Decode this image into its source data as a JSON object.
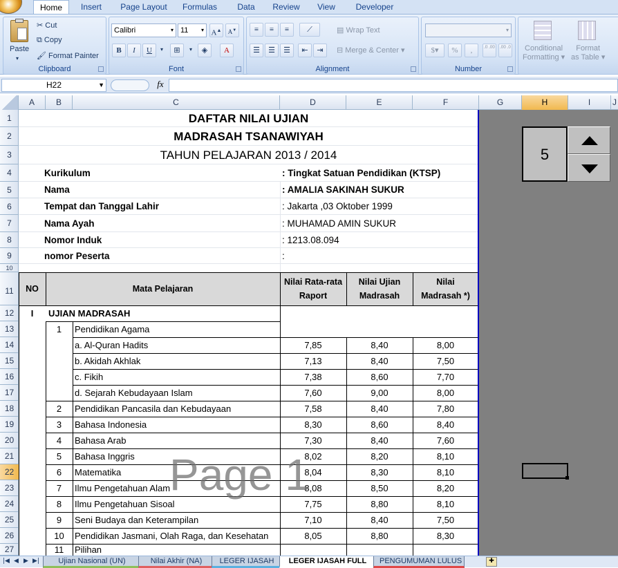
{
  "ribbon_tabs": [
    "Home",
    "Insert",
    "Page Layout",
    "Formulas",
    "Data",
    "Review",
    "View",
    "Developer"
  ],
  "clipboard": {
    "label": "Clipboard",
    "paste": "Paste",
    "cut": "Cut",
    "copy": "Copy",
    "format_painter": "Format Painter"
  },
  "font": {
    "label": "Font",
    "name": "Calibri",
    "size": "11",
    "grow": "A",
    "shrink": "A",
    "bold": "B",
    "italic": "I",
    "underline": "U",
    "font_color": "A"
  },
  "alignment": {
    "label": "Alignment",
    "wrap_text": "Wrap Text",
    "merge_center": "Merge & Center"
  },
  "number": {
    "label": "Number",
    "percent": "%",
    "comma": ",",
    "inc_decimal": ".0 .00",
    "dec_decimal": ".00 .0"
  },
  "styles": {
    "conditional": "Conditional",
    "formatting": "Formatting",
    "format": "Format",
    "as_table": "as Table"
  },
  "formula_bar": {
    "name_box": "H22",
    "fx": "fx",
    "value": ""
  },
  "columns": [
    "A",
    "B",
    "C",
    "D",
    "E",
    "F",
    "G",
    "H",
    "I",
    "J"
  ],
  "rows": [
    "1",
    "2",
    "3",
    "4",
    "5",
    "6",
    "7",
    "8",
    "9",
    "10",
    "11",
    "12",
    "13",
    "14",
    "15",
    "16",
    "17",
    "18",
    "19",
    "20",
    "21",
    "22",
    "23",
    "24",
    "25",
    "26",
    "27"
  ],
  "selected_row": "22",
  "selected_col": "H",
  "doc": {
    "title1": "DAFTAR NILAI UJIAN",
    "title2": "MADRASAH TSANAWIYAH",
    "title3": "TAHUN PELAJARAN 2013 / 2014",
    "info": [
      {
        "label": "Kurikulum",
        "value": ": Tingkat Satuan Pendidikan (KTSP)",
        "bold": true
      },
      {
        "label": "Nama",
        "value": ": AMALIA SAKINAH SUKUR",
        "bold": true
      },
      {
        "label": "Tempat dan Tanggal Lahir",
        "value": ": Jakarta ,03 Oktober 1999",
        "bold": false
      },
      {
        "label": "Nama Ayah",
        "value": ": MUHAMAD AMIN SUKUR",
        "bold": false
      },
      {
        "label": "Nomor Induk",
        "value": ": 1213.08.094",
        "bold": false
      },
      {
        "label": "nomor Peserta",
        "value": ":",
        "bold": false
      }
    ],
    "table_headers": {
      "no": "NO",
      "subject": "Mata Pelajaran",
      "raport_1": "Nilai Rata-rata",
      "raport_2": "Raport",
      "ujian_1": "Nilai Ujian",
      "ujian_2": "Madrasah",
      "nilai_1": "Nilai",
      "nilai_2": "Madrasah *)"
    },
    "section_no": "I",
    "section_title": "UJIAN MADRASAH",
    "subjects": [
      {
        "no": "1",
        "name": "Pendidikan Agama",
        "raport": "",
        "ujian": "",
        "nilai": "",
        "sub": false
      },
      {
        "no": "",
        "name": "a.  Al-Quran Hadits",
        "raport": "7,85",
        "ujian": "8,40",
        "nilai": "8,00",
        "sub": true
      },
      {
        "no": "",
        "name": "b.  Akidah Akhlak",
        "raport": "7,13",
        "ujian": "8,40",
        "nilai": "7,50",
        "sub": true
      },
      {
        "no": "",
        "name": "c.  Fikih",
        "raport": "7,38",
        "ujian": "8,60",
        "nilai": "7,70",
        "sub": true
      },
      {
        "no": "",
        "name": "d. Sejarah Kebudayaan Islam",
        "raport": "7,60",
        "ujian": "9,00",
        "nilai": "8,00",
        "sub": true
      },
      {
        "no": "2",
        "name": "Pendidikan Pancasila dan Kebudayaan",
        "raport": "7,58",
        "ujian": "8,40",
        "nilai": "7,80",
        "sub": false
      },
      {
        "no": "3",
        "name": "Bahasa Indonesia",
        "raport": "8,30",
        "ujian": "8,60",
        "nilai": "8,40",
        "sub": false
      },
      {
        "no": "4",
        "name": "Bahasa Arab",
        "raport": "7,30",
        "ujian": "8,40",
        "nilai": "7,60",
        "sub": false
      },
      {
        "no": "5",
        "name": "Bahasa Inggris",
        "raport": "8,02",
        "ujian": "8,20",
        "nilai": "8,10",
        "sub": false
      },
      {
        "no": "6",
        "name": "Matematika",
        "raport": "8,04",
        "ujian": "8,30",
        "nilai": "8,10",
        "sub": false
      },
      {
        "no": "7",
        "name": "Ilmu Pengetahuan Alam",
        "raport": "8,08",
        "ujian": "8,50",
        "nilai": "8,20",
        "sub": false
      },
      {
        "no": "8",
        "name": "Ilmu Pengetahuan Sisoal",
        "raport": "7,75",
        "ujian": "8,80",
        "nilai": "8,10",
        "sub": false
      },
      {
        "no": "9",
        "name": "Seni Budaya dan Keterampilan",
        "raport": "7,10",
        "ujian": "8,40",
        "nilai": "7,50",
        "sub": false
      },
      {
        "no": "10",
        "name": "Pendidikan Jasmani, Olah Raga, dan Kesehatan",
        "raport": "8,05",
        "ujian": "8,80",
        "nilai": "8,30",
        "sub": false
      },
      {
        "no": "11",
        "name": "Pilihan",
        "raport": "",
        "ujian": "",
        "nilai": "",
        "sub": false
      }
    ]
  },
  "watermark": "Page 1",
  "spinner": {
    "value": "5"
  },
  "sheet_tabs": [
    {
      "name": "Ujian Nasional (UN)",
      "color": "#8fbf5a",
      "active": false
    },
    {
      "name": "Nilai Akhir (NA)",
      "color": "#e06060",
      "active": false
    },
    {
      "name": "LEGER IJASAH",
      "color": "#5ab0e0",
      "active": false
    },
    {
      "name": "LEGER IJASAH FULL",
      "color": "#ffffff",
      "active": true
    },
    {
      "name": "PENGUMUMAN LULUS",
      "color": "#e04848",
      "active": false
    }
  ]
}
